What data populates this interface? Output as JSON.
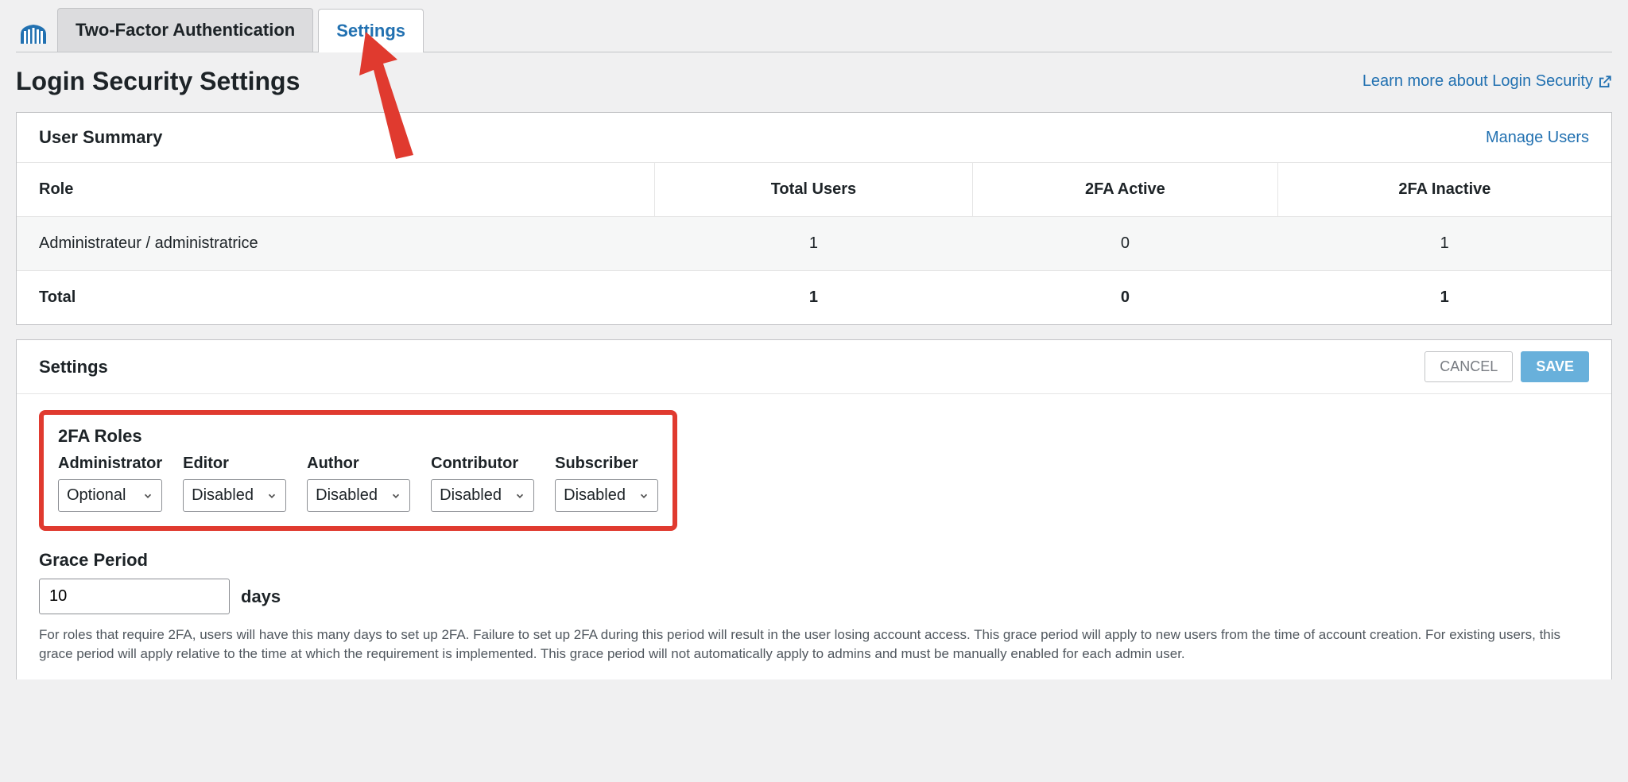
{
  "tabs": {
    "two_factor": "Two-Factor Authentication",
    "settings": "Settings"
  },
  "page_title": "Login Security Settings",
  "learn_more": "Learn more about Login Security",
  "user_summary": {
    "title": "User Summary",
    "manage": "Manage Users",
    "columns": {
      "role": "Role",
      "total": "Total Users",
      "active": "2FA Active",
      "inactive": "2FA Inactive"
    },
    "rows": [
      {
        "role": "Administrateur / administratrice",
        "total": "1",
        "active": "0",
        "inactive": "1"
      },
      {
        "role": "Total",
        "total": "1",
        "active": "0",
        "inactive": "1"
      }
    ]
  },
  "settings": {
    "title": "Settings",
    "cancel": "CANCEL",
    "save": "SAVE",
    "roles_title": "2FA Roles",
    "roles": [
      {
        "name": "Administrator",
        "value": "Optional"
      },
      {
        "name": "Editor",
        "value": "Disabled"
      },
      {
        "name": "Author",
        "value": "Disabled"
      },
      {
        "name": "Contributor",
        "value": "Disabled"
      },
      {
        "name": "Subscriber",
        "value": "Disabled"
      }
    ],
    "grace_title": "Grace Period",
    "grace_value": "10",
    "grace_unit": "days",
    "grace_desc": "For roles that require 2FA, users will have this many days to set up 2FA. Failure to set up 2FA during this period will result in the user losing account access. This grace period will apply to new users from the time of account creation. For existing users, this grace period will apply relative to the time at which the requirement is implemented. This grace period will not automatically apply to admins and must be manually enabled for each admin user."
  }
}
